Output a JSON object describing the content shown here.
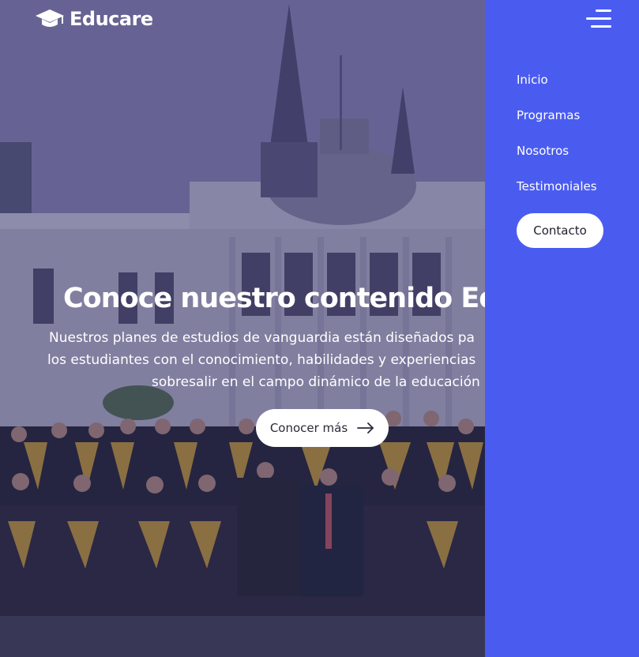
{
  "brand": {
    "name": "Educare",
    "icon": "graduation-cap-icon"
  },
  "hero": {
    "title": "Conoce nuestro contenido Edu",
    "subtitle_lines": [
      "Nuestros planes de estudios de vanguardia están diseñados pa",
      "los estudiantes con el conocimiento, habilidades y experiencias",
      "sobresalir en el campo dinámico de la educación"
    ],
    "cta_label": "Conocer más",
    "cta_icon": "arrow-right-icon"
  },
  "nav": {
    "toggle_icon": "menu-icon",
    "items": [
      "Inicio",
      "Programas",
      "Nosotros",
      "Testimoniales"
    ],
    "contact_label": "Contacto"
  },
  "colors": {
    "panel": "#4a5cf0",
    "button_bg": "#ffffff",
    "text": "#ffffff"
  }
}
